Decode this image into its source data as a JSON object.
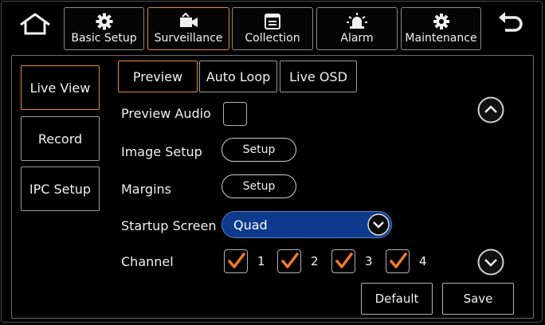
{
  "top_tabs": [
    {
      "label": "Basic Setup",
      "icon": "gear-icon"
    },
    {
      "label": "Surveillance",
      "icon": "camera-icon",
      "active": true
    },
    {
      "label": "Collection",
      "icon": "collection-icon"
    },
    {
      "label": "Alarm",
      "icon": "alarm-light-icon"
    },
    {
      "label": "Maintenance",
      "icon": "maintenance-gear-icon"
    }
  ],
  "side_menu": [
    {
      "label": "Live View",
      "active": true
    },
    {
      "label": "Record"
    },
    {
      "label": "IPC Setup"
    }
  ],
  "sub_tabs": [
    {
      "label": "Preview",
      "active": true
    },
    {
      "label": "Auto Loop"
    },
    {
      "label": "Live OSD"
    }
  ],
  "form": {
    "preview_audio": {
      "label": "Preview Audio",
      "checked": false
    },
    "image_setup": {
      "label": "Image Setup",
      "button": "Setup"
    },
    "margins": {
      "label": "Margins",
      "button": "Setup"
    },
    "startup_screen": {
      "label": "Startup Screen",
      "value": "Quad"
    },
    "channel": {
      "label": "Channel",
      "items": [
        {
          "num": "1",
          "checked": true
        },
        {
          "num": "2",
          "checked": true
        },
        {
          "num": "3",
          "checked": true
        },
        {
          "num": "4",
          "checked": true
        }
      ]
    }
  },
  "actions": {
    "default_label": "Default",
    "save_label": "Save"
  },
  "colors": {
    "accent": "#e08a2c",
    "select_bg": "#0d3a8c",
    "check": "#f07a2a"
  }
}
